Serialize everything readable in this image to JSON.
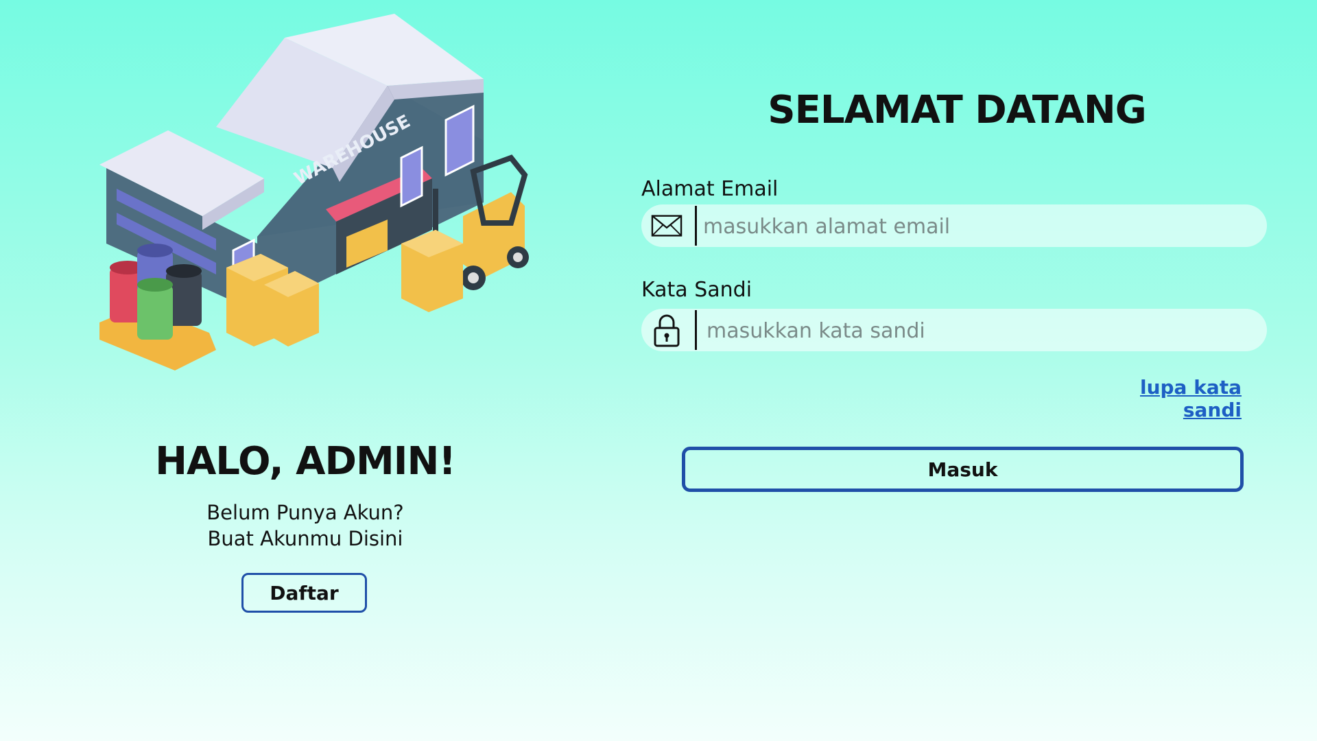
{
  "left": {
    "greeting": "HALO, ADMIN!",
    "subtitle_line1": "Belum Punya Akun?",
    "subtitle_line2": "Buat Akunmu Disini",
    "register_label": "Daftar",
    "illustration_sign": "WAREHOUSE"
  },
  "form": {
    "title": "SELAMAT DATANG",
    "email_label": "Alamat Email",
    "email_placeholder": "masukkan alamat email",
    "email_icon": "envelope-icon",
    "password_label": "Kata Sandi",
    "password_placeholder": "masukkan kata sandi",
    "password_icon": "lock-icon",
    "forgot_label": "lupa kata sandi",
    "submit_label": "Masuk"
  },
  "colors": {
    "background_top": "#76fbe2",
    "background_bottom": "#f3fffc",
    "button_border": "#1f4fa8",
    "link": "#1d5fc4"
  }
}
